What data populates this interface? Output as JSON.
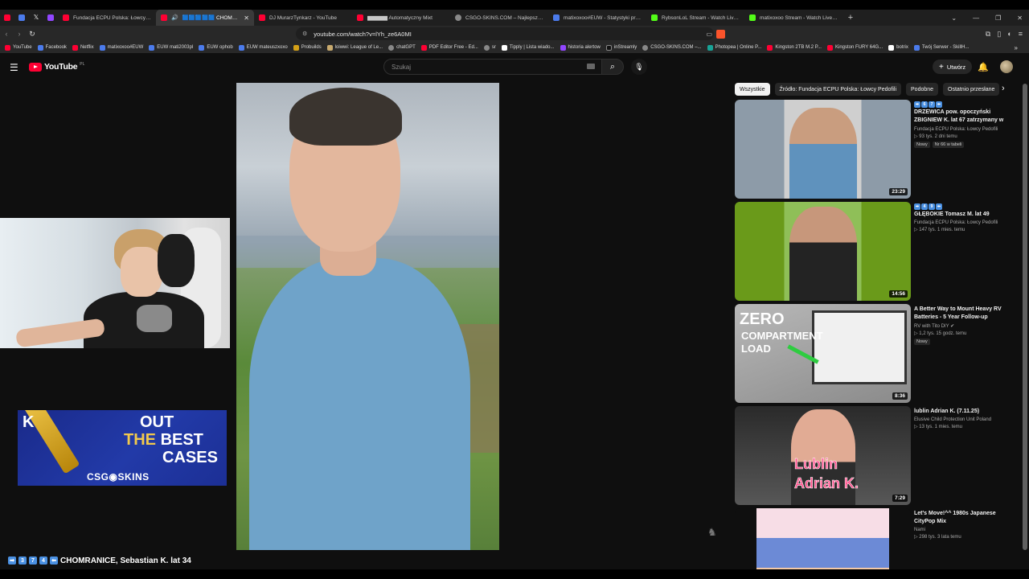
{
  "browser": {
    "tabs": [
      {
        "label": "Fundacja ECPU Polska: Łowcy Pedofil",
        "favicon": "youtube-icon",
        "active": false
      },
      {
        "label": "🟦🟦🟦🟦🟦 CHOMRANIC",
        "favicon": "youtube-icon",
        "active": true
      },
      {
        "label": "DJ MurarzTynkarz - YouTube",
        "favicon": "youtube-icon",
        "active": false
      },
      {
        "label": "▆▆▆▆▆ Automatyczny Mixt",
        "favicon": "youtube-icon",
        "active": false
      },
      {
        "label": "CSGO-SKINS.COM – Najlepsze Skrzy",
        "favicon": "globe-icon",
        "active": false
      },
      {
        "label": "matixoxoo#EUW - Statystyki przywo",
        "favicon": "opgg-icon",
        "active": false
      },
      {
        "label": "RybsonLoL Stream - Watch Live on K",
        "favicon": "kick-icon",
        "active": false
      },
      {
        "label": "matixoxoo Stream - Watch Live on K",
        "favicon": "kick-icon",
        "active": false
      }
    ],
    "close_glyph": "✕",
    "new_tab_glyph": "+",
    "url": "youtube.com/watch?v=lYh_ze6A0MI",
    "bookmarks": [
      {
        "label": "YouTube",
        "icon": "youtube-icon"
      },
      {
        "label": "Facebook",
        "icon": "facebook-icon"
      },
      {
        "label": "Netflix",
        "icon": "netflix-icon"
      },
      {
        "label": "matixoxoo#EUW",
        "icon": "opgg-icon"
      },
      {
        "label": "EUW mati2003pl",
        "icon": "opgg-icon"
      },
      {
        "label": "EUW ophob",
        "icon": "opgg-icon"
      },
      {
        "label": "EUW mateuszxoxo",
        "icon": "opgg-icon"
      },
      {
        "label": "Probuilds",
        "icon": "probuilds-icon"
      },
      {
        "label": "loiwwi: League of Le...",
        "icon": "league-icon"
      },
      {
        "label": "chatGPT",
        "icon": "chatgpt-icon"
      },
      {
        "label": "PDF Editor Free - Ed...",
        "icon": "pdf-icon"
      },
      {
        "label": "sr",
        "icon": "sr-icon"
      },
      {
        "label": "Tipply | Lista wiado...",
        "icon": "tipply-icon"
      },
      {
        "label": "historia alertow",
        "icon": "alerts-icon"
      },
      {
        "label": "inStreamly",
        "icon": "instreamly-icon"
      },
      {
        "label": "CSGO-SKINS.COM –...",
        "icon": "globe-icon"
      },
      {
        "label": "Photopea | Online P...",
        "icon": "photopea-icon"
      },
      {
        "label": "Kingston 2TB M.2 P...",
        "icon": "kingston-icon"
      },
      {
        "label": "Kingston FURY 64G...",
        "icon": "kingston-icon"
      },
      {
        "label": "botrix",
        "icon": "botrix-icon"
      },
      {
        "label": "Twój Serwer - SkillH...",
        "icon": "server-icon"
      }
    ]
  },
  "youtube": {
    "logo_text": "YouTube",
    "region": "PL",
    "search_placeholder": "Szukaj",
    "create_label": "Utwórz",
    "video_title": "CHOMRANICE, Sebastian K. lat 34",
    "title_emoji": [
      "➡",
      "3",
      "7",
      "4",
      "⬅"
    ],
    "chips": [
      "Wszystkie",
      "Źródło: Fundacja ECPU Polska: Łowcy Pedofili",
      "Podobne",
      "Ostatnio przesłane"
    ],
    "recommendations": [
      {
        "title": "DRZEWICA pow. opoczyński ZBIGNIEW K. lat 67 zatrzymany w Kazimierkach pow. ...",
        "emoji": [
          "➡",
          "6",
          "7",
          "⬅"
        ],
        "channel": "Fundacja ECPU Polska: Łowcy Pedofili",
        "views": "93 tys.",
        "age": "2 dni temu",
        "badges": [
          "Nowy",
          "Nr 66 w tabeli"
        ],
        "duration": "23:29"
      },
      {
        "title": "GŁĘBOKIE Tomasz M. lat 49",
        "emoji": [
          "➡",
          "4",
          "9",
          "⬅"
        ],
        "channel": "Fundacja ECPU Polska: Łowcy Pedofili",
        "views": "147 tys.",
        "age": "1 mies. temu",
        "badges": [],
        "duration": "14:56"
      },
      {
        "title": "A Better Way to Mount Heavy RV Batteries - 5 Year Follow-up",
        "emoji": [],
        "channel": "RV with Tito DIY",
        "views": "1,2 tys.",
        "age": "15 godz. temu",
        "badges": [
          "Nowy"
        ],
        "duration": "8:36",
        "thumb_text": [
          "ZERO",
          "COMPARTMENT",
          "LOAD"
        ]
      },
      {
        "title": "lublin Adrian K. (7.11.25)",
        "emoji": [],
        "channel": "Elusive Child Protection Unit Poland",
        "views": "13 tys.",
        "age": "1 mies. temu",
        "badges": [],
        "duration": "7:29",
        "thumb_text": [
          "Lublin",
          "Adrian K."
        ]
      },
      {
        "title": "Let's Move!^^ 1980s Japanese CityPop Mix",
        "emoji": [],
        "channel": "Nami",
        "views": "298 tys.",
        "age": "3 lata temu",
        "badges": [],
        "duration": ""
      }
    ]
  },
  "overlay": {
    "banner_line1": "OUT",
    "banner_line2a": "THE",
    "banner_line2b": "BEST",
    "banner_line3": "CASES",
    "banner_logo": "CSG◉SKINS",
    "banner_partial": "K"
  },
  "colors": {
    "accent": "#ff0033",
    "background": "#0f0f0f",
    "chip_active": "#f1f1f1",
    "banner_blue": "#223aa8",
    "banner_gold": "#f2c94c"
  }
}
